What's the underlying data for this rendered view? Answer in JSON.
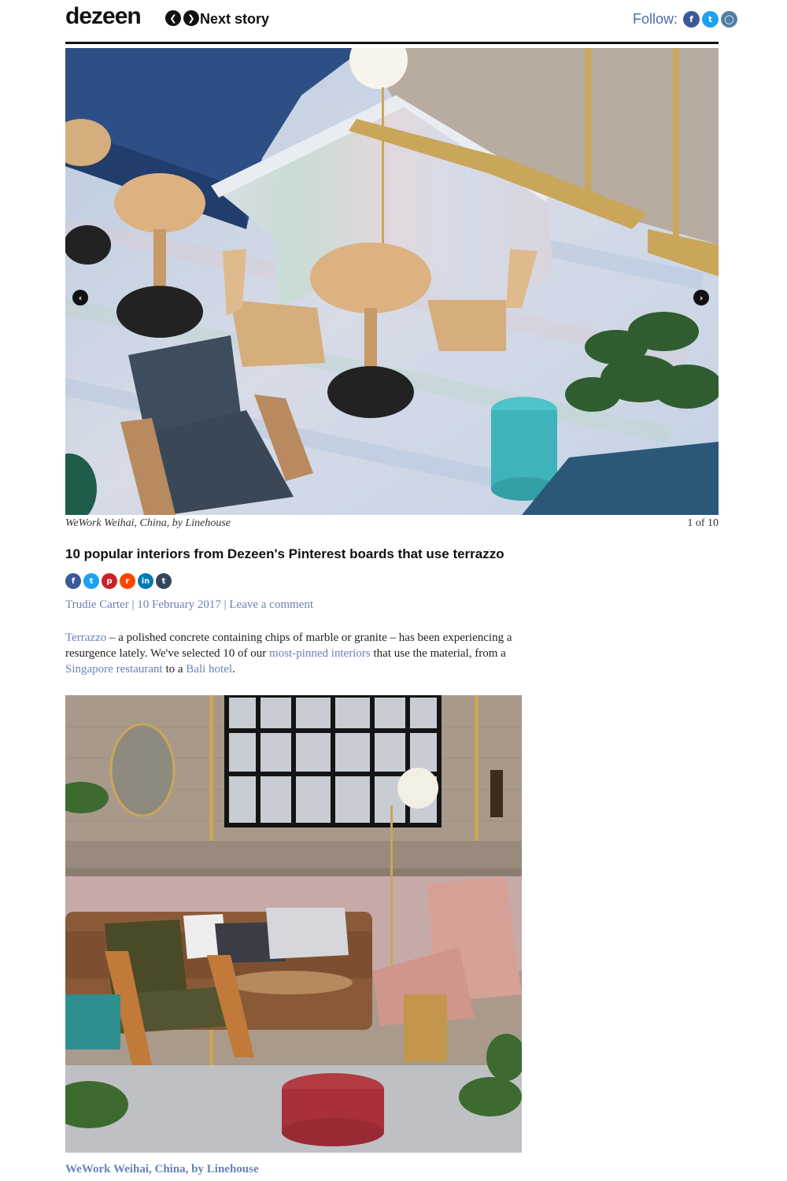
{
  "header": {
    "logo": "dezeen",
    "prev_icon": "chevron-left-icon",
    "next_icon": "chevron-right-icon",
    "next_story": "Next story",
    "follow_label": "Follow:",
    "follow_icons": [
      "facebook-icon",
      "twitter-icon",
      "instagram-icon"
    ]
  },
  "gallery": {
    "caption": "WeWork Weihai, China, by Linehouse",
    "counter": "1 of 10",
    "prev_glyph": "‹",
    "next_glyph": "›"
  },
  "article": {
    "title": "10 popular interiors from Dezeen's Pinterest boards that use terrazzo",
    "share_icons": [
      "facebook-icon",
      "twitter-icon",
      "pinterest-icon",
      "reddit-icon",
      "linkedin-icon",
      "tumblr-icon"
    ],
    "author": "Trudie Carter",
    "date": "10 February 2017",
    "comment_link": "Leave a comment",
    "intro": {
      "link1": "Terrazzo",
      "text1": " – a polished concrete containing chips of marble or granite – has been experiencing a resurgence lately. We've selected 10 of our ",
      "link2": "most-pinned interiors",
      "text2": " that use the material, from a ",
      "link3": "Singapore restaurant",
      "text3": " to a ",
      "link4": "Bali hotel",
      "text4": "."
    },
    "photo_caption": "WeWork Weihai, China, by Linehouse"
  },
  "colors": {
    "link": "#6b80b8",
    "facebook": "#3b5998",
    "twitter": "#1da1f2",
    "instagram": "#517fa4",
    "pinterest": "#cb2027",
    "reddit": "#ff4500",
    "linkedin": "#0077b5",
    "tumblr": "#35465c"
  }
}
